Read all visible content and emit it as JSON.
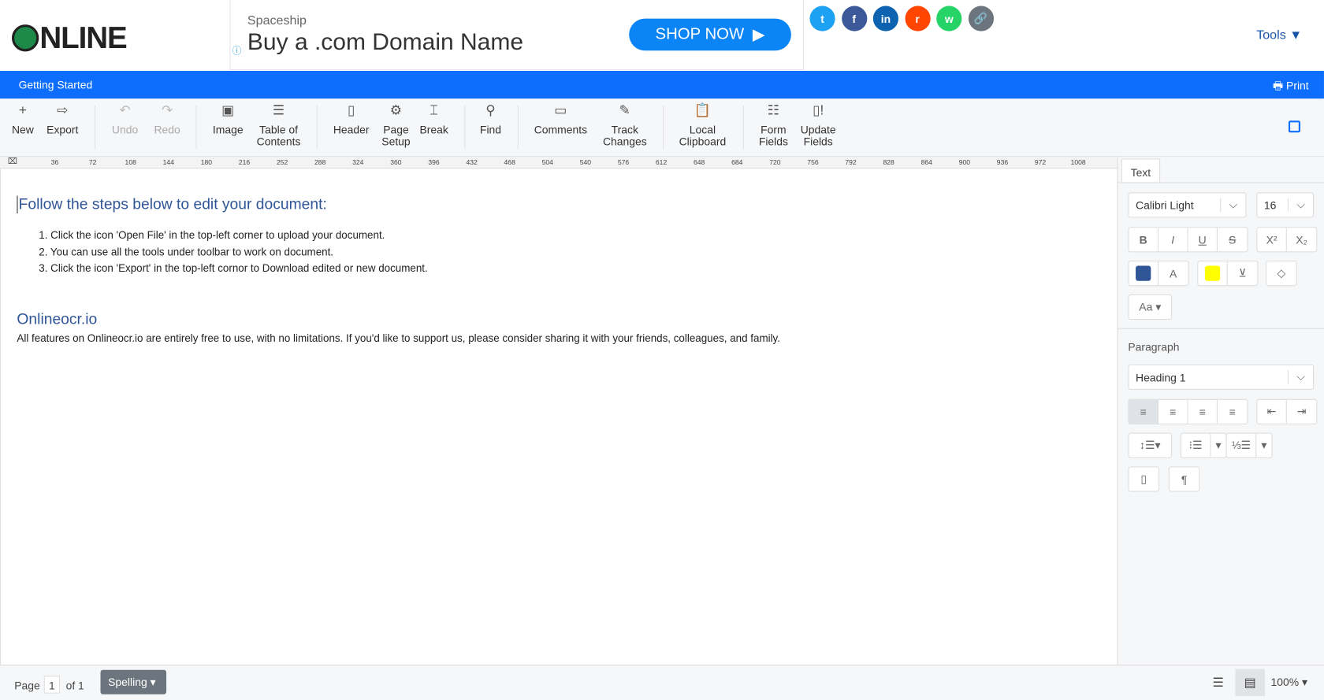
{
  "header": {
    "logo_text": "NLINE",
    "ad": {
      "brand": "Spaceship",
      "title": "Buy a .com Domain Name",
      "cta": "SHOP NOW"
    },
    "social": [
      {
        "name": "twitter",
        "glyph": "t",
        "color": "#1da1f2"
      },
      {
        "name": "facebook",
        "glyph": "f",
        "color": "#3b5998"
      },
      {
        "name": "linkedin",
        "glyph": "in",
        "color": "#0e63b0"
      },
      {
        "name": "reddit",
        "glyph": "r",
        "color": "#ff4500"
      },
      {
        "name": "whatsapp",
        "glyph": "w",
        "color": "#25d366"
      },
      {
        "name": "link",
        "glyph": "🔗",
        "color": "#6c757d"
      }
    ],
    "tools": "Tools ▼"
  },
  "bar": {
    "title": "Getting Started",
    "print": "Print"
  },
  "toolbar": [
    {
      "label": "New",
      "icon": "+"
    },
    {
      "label": "Export",
      "icon": "⇨"
    },
    {
      "label": "Undo",
      "icon": "↶",
      "disabled": true
    },
    {
      "label": "Redo",
      "icon": "↷",
      "disabled": true
    },
    {
      "label": "Image",
      "icon": "▣"
    },
    {
      "label": "Table of\nContents",
      "icon": "☰"
    },
    {
      "label": "Header",
      "icon": "▯"
    },
    {
      "label": "Page\nSetup",
      "icon": "⚙"
    },
    {
      "label": "Break",
      "icon": "⌶"
    },
    {
      "label": "Find",
      "icon": "⚲"
    },
    {
      "label": "Comments",
      "icon": "▭"
    },
    {
      "label": "Track\nChanges",
      "icon": "✎"
    },
    {
      "label": "Local\nClipboard",
      "icon": "📋"
    },
    {
      "label": "Form\nFields",
      "icon": "☷"
    },
    {
      "label": "Update\nFields",
      "icon": "▯!"
    }
  ],
  "ruler": [
    "36",
    "72",
    "108",
    "144",
    "180",
    "216",
    "252",
    "288",
    "324",
    "360",
    "396",
    "432",
    "468",
    "504",
    "540",
    "576",
    "612",
    "648",
    "684",
    "720",
    "756",
    "792",
    "828",
    "864",
    "900",
    "936",
    "972",
    "1008"
  ],
  "document": {
    "heading": "Follow the steps below to edit your document:",
    "steps": [
      "1. Click the icon 'Open File' in the top-left corner to upload your document.",
      "2. You can use all the tools under toolbar to work on document.",
      "3. Click the icon 'Export' in the top-left cornor to Download edited or new document."
    ],
    "subheading": "Onlineocr.io",
    "paragraph": "All features on Onlineocr.io are entirely free to use, with no limitations. If you'd like to support us, please consider sharing it with your friends, colleagues, and family."
  },
  "panel": {
    "tab": "Text",
    "font": "Calibri Light",
    "size": "16",
    "font_color": "#2f5597",
    "highlight_color": "#ffff00",
    "case": "Aa ▾",
    "paragraph_label": "Paragraph",
    "style": "Heading 1"
  },
  "status": {
    "page_label": "Page",
    "page": "1",
    "of": "of 1",
    "spelling": "Spelling ▾",
    "zoom": "100% ▾"
  }
}
